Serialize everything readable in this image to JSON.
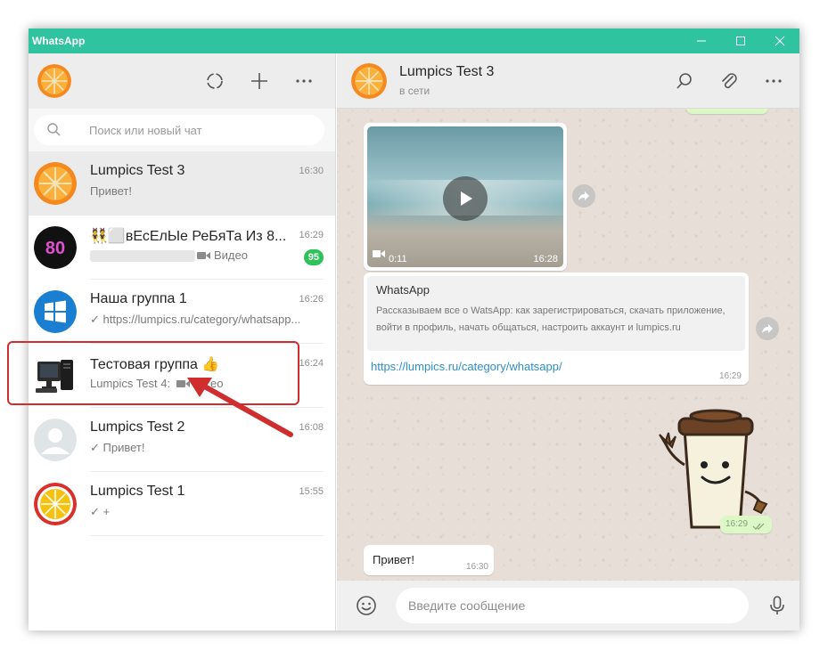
{
  "window": {
    "title": "WhatsApp",
    "accent_color": "#2fc3a0"
  },
  "left_header": {
    "icons": [
      "status-icon",
      "new-chat-icon",
      "menu-icon"
    ]
  },
  "search": {
    "placeholder": "Поиск или новый чат"
  },
  "chats": [
    {
      "name": "Lumpics Test 3",
      "time": "16:30",
      "preview": "Привет!",
      "avatar": "orange"
    },
    {
      "name": "👯⬜вЕсЕлЫе РеБяТа Из 8...",
      "time": "16:29",
      "preview": "Видео",
      "unread": "95",
      "avatar": "eighties"
    },
    {
      "name": "Наша группа 1",
      "time": "16:26",
      "preview": "✓ https://lumpics.ru/category/whatsapp...",
      "avatar": "windows"
    },
    {
      "name": "Тестовая группа 👍",
      "time": "16:24",
      "preview": "Lumpics Test 4:",
      "preview_suffix": "eo",
      "avatar": "computer"
    },
    {
      "name": "Lumpics Test 2",
      "time": "16:08",
      "preview": "✓ Привет!",
      "avatar": "default"
    },
    {
      "name": "Lumpics Test 1",
      "time": "15:55",
      "preview": "✓ +",
      "avatar": "lemon"
    }
  ],
  "conversation": {
    "name": "Lumpics Test 3",
    "status": "в сети",
    "messages": {
      "video": {
        "duration": "0:11",
        "time": "16:28"
      },
      "link": {
        "title": "WhatsApp",
        "description": "Рассказываем все о WatsApp: как зарегистрироваться, скачать приложение, войти в профиль, начать общаться, настроить аккаунт и lumpics.ru",
        "url": "https://lumpics.ru/category/whatsapp/",
        "time": "16:29"
      },
      "sticker": {
        "time": "16:29"
      },
      "text": {
        "body": "Привет!",
        "time": "16:30"
      }
    }
  },
  "composer": {
    "placeholder": "Введите сообщение"
  },
  "colors": {
    "unread_badge": "#2fc25b",
    "highlight": "#d02e2e",
    "link": "#2f8fc7",
    "outgoing_bubble": "#dcf8c6"
  }
}
